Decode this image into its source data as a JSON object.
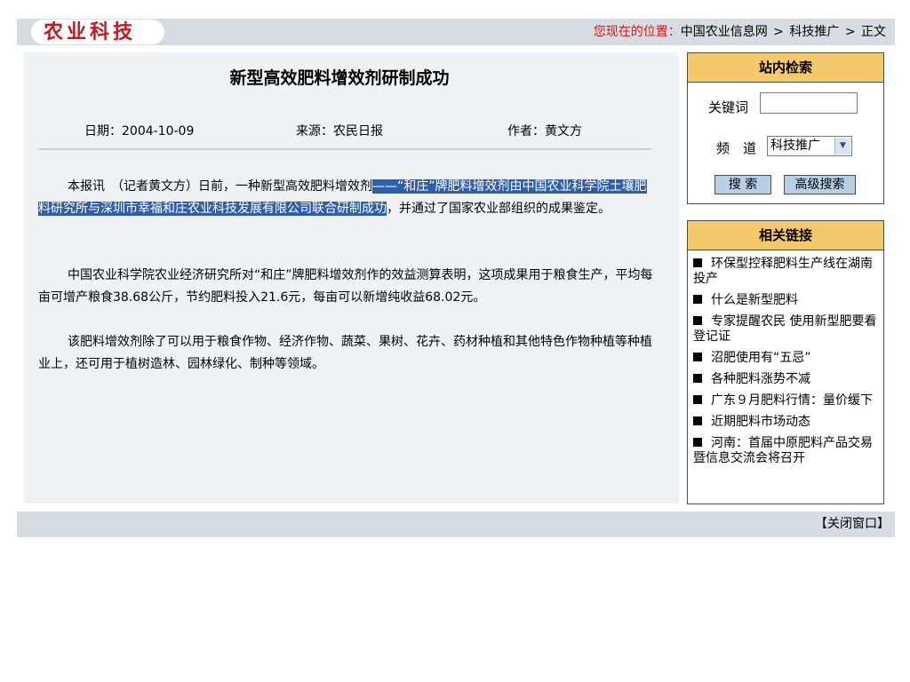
{
  "header": {
    "logo_text": "农业科技",
    "breadcrumb_prefix": "您现在的位置：",
    "breadcrumb": [
      "中国农业信息网",
      "科技推广",
      "正文"
    ],
    "breadcrumb_separator": ">"
  },
  "article": {
    "title": "新型高效肥料增效剂研制成功",
    "date": "日期：2004-10-09",
    "source": "来源：农民日报",
    "author": "作者：黄文方",
    "paragraph1_before": "本报讯　（记者黄文方）日前，一种新型高效肥料增效剂",
    "paragraph1_selected": "——“和庄”牌肥料增效剂由中国农业科学院土壤肥料研究所与深圳市幸福和庄农业科技发展有限公司联合研制成功",
    "paragraph1_after": "，并通过了国家农业部组织的成果鉴定。",
    "paragraph2": "中国农业科学院农业经济研究所对“和庄”牌肥料增效剂作的效益测算表明，这项成果用于粮食生产，平均每亩可增产粮食38.68公斤，节约肥料投入21.6元，每亩可以新增纯收益68.02元。",
    "paragraph3": "该肥料增效剂除了可以用于粮食作物、经济作物、蔬菜、果树、花卉、药材种植和其他特色作物种植等种植业上，还可用于植树造林、园林绿化、制种等领域。"
  },
  "search": {
    "title": "站内检索",
    "keyword_label": "关键词",
    "keyword_value": "",
    "channel_label": "频　道",
    "channel_selected": "科技推广",
    "search_button": "搜 索",
    "advanced_button": "高级搜索"
  },
  "related": {
    "title": "相关链接",
    "items": [
      "环保型控释肥料生产线在湖南投产",
      "什么是新型肥料",
      "专家提醒农民 使用新型肥要看登记证",
      "沼肥使用有“五忌”",
      "各种肥料涨势不减",
      "广东９月肥料行情：量价缓下",
      "近期肥料市场动态",
      "河南：首届中原肥料产品交易暨信息交流会将召开"
    ]
  },
  "footer": {
    "close_label": "【关闭窗口】"
  },
  "colors": {
    "header_bar": "#d5dde2",
    "panel_bg": "#eef2f5",
    "box_header": "#f5c86a",
    "logo_red": "#c8171e",
    "selection": "#2f5fa8",
    "button": "#b6d0e8"
  }
}
